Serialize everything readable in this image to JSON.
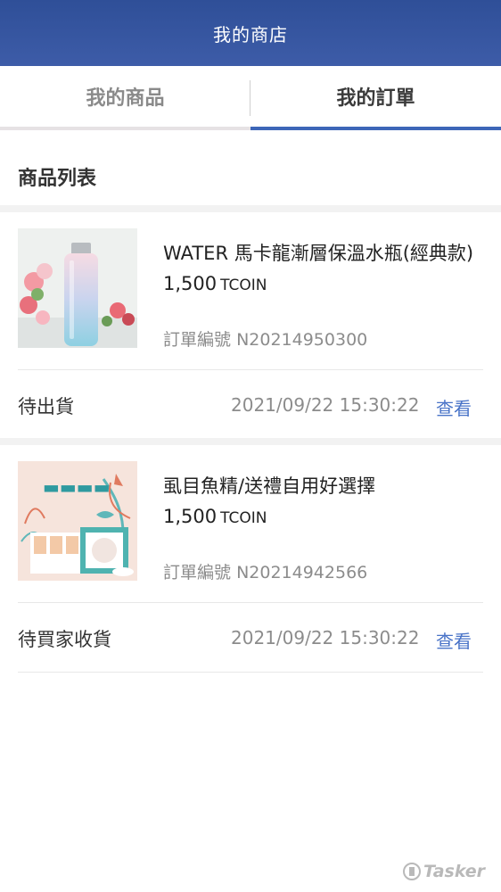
{
  "header": {
    "title": "我的商店"
  },
  "tabs": {
    "products_label": "我的商品",
    "orders_label": "我的訂單",
    "active": "orders"
  },
  "section": {
    "title": "商品列表"
  },
  "orders": [
    {
      "product_name": "WATER 馬卡龍漸層保溫水瓶(經典款)",
      "price": "1,500",
      "price_unit": "TCOIN",
      "order_label": "訂單編號",
      "order_number": "N20214950300",
      "status": "待出貨",
      "datetime": "2021/09/22 15:30:22",
      "view_label": "查看",
      "image_icon": "water-bottle-product-image"
    },
    {
      "product_name": "虱目魚精/送禮自用好選擇",
      "price": "1,500",
      "price_unit": "TCOIN",
      "order_label": "訂單編號",
      "order_number": "N20214942566",
      "status": "待買家收貨",
      "datetime": "2021/09/22 15:30:22",
      "view_label": "查看",
      "image_icon": "fish-essence-product-image"
    }
  ],
  "watermark": {
    "text": "Tasker"
  },
  "colors": {
    "header_bg": "#3a58a2",
    "active_tab_underline": "#3d66b8",
    "link": "#4a74c8"
  }
}
